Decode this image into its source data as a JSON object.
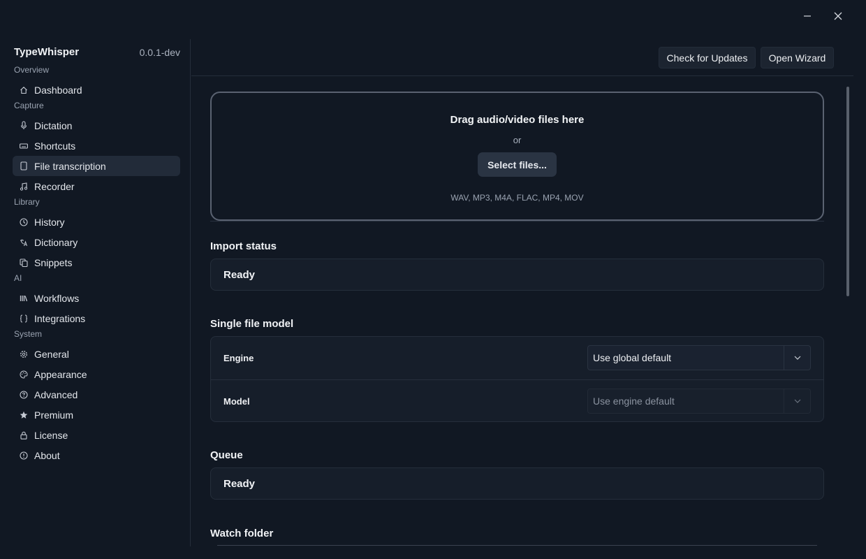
{
  "window": {
    "minimize_icon": "minimize-icon",
    "close_icon": "close-icon"
  },
  "sidebar": {
    "app_name": "TypeWhisper",
    "version": "0.0.1-dev",
    "sections": [
      {
        "label": "Overview",
        "items": [
          {
            "label": "Dashboard",
            "icon": "home-icon"
          }
        ]
      },
      {
        "label": "Capture",
        "items": [
          {
            "label": "Dictation",
            "icon": "microphone-icon"
          },
          {
            "label": "Shortcuts",
            "icon": "keyboard-icon"
          },
          {
            "label": "File transcription",
            "icon": "file-icon",
            "active": true
          },
          {
            "label": "Recorder",
            "icon": "music-note-icon"
          }
        ]
      },
      {
        "label": "Library",
        "items": [
          {
            "label": "History",
            "icon": "history-icon"
          },
          {
            "label": "Dictionary",
            "icon": "translate-icon"
          },
          {
            "label": "Snippets",
            "icon": "copy-icon"
          }
        ]
      },
      {
        "label": "AI",
        "items": [
          {
            "label": "Workflows",
            "icon": "library-icon"
          },
          {
            "label": "Integrations",
            "icon": "braces-icon"
          }
        ]
      },
      {
        "label": "System",
        "items": [
          {
            "label": "General",
            "icon": "gear-icon"
          },
          {
            "label": "Appearance",
            "icon": "palette-icon"
          },
          {
            "label": "Advanced",
            "icon": "help-circle-icon"
          },
          {
            "label": "Premium",
            "icon": "star-icon"
          },
          {
            "label": "License",
            "icon": "lock-icon"
          },
          {
            "label": "About",
            "icon": "info-icon"
          }
        ]
      }
    ]
  },
  "header": {
    "check_updates_label": "Check for Updates",
    "open_wizard_label": "Open Wizard"
  },
  "dropzone": {
    "title": "Drag audio/video files here",
    "or_text": "or",
    "select_button": "Select files...",
    "formats": "WAV, MP3, M4A, FLAC, MP4, MOV"
  },
  "import_status": {
    "title": "Import status",
    "value": "Ready"
  },
  "single_file_model": {
    "title": "Single file model",
    "engine_label": "Engine",
    "engine_value": "Use global default",
    "model_label": "Model",
    "model_value": "Use engine default"
  },
  "queue": {
    "title": "Queue",
    "value": "Ready"
  },
  "watch_folder": {
    "title": "Watch folder"
  }
}
